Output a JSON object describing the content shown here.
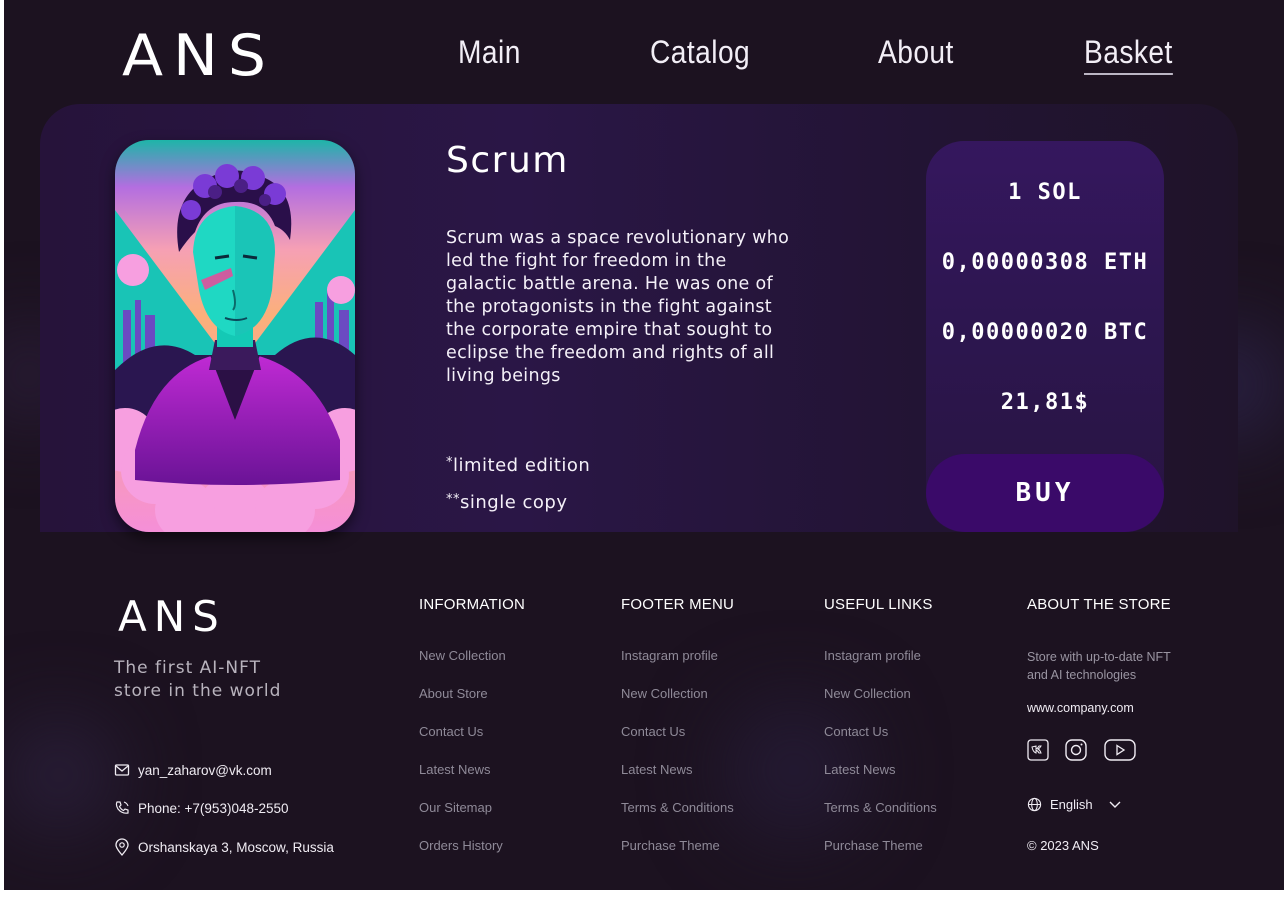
{
  "header": {
    "logo": "ANS",
    "nav": [
      "Main",
      "Catalog",
      "About",
      "Basket"
    ]
  },
  "product": {
    "name": "Scrum",
    "description": "Scrum was a space revolutionary who led the fight for freedom in the galactic battle arena. He was one of the protagonists in the fight against the corporate empire that sought to eclipse the freedom and rights of all living beings",
    "note1_mark": "*",
    "note1": "limited edition",
    "note2_mark": "**",
    "note2": "single copy",
    "prices": [
      "1 SOL",
      "0,00000308 ETH",
      "0,00000020 BTC",
      "21,81$"
    ],
    "buy_label": "BUY"
  },
  "footer": {
    "logo": "ANS",
    "tagline": "The first AI-NFT store in the world",
    "contacts": {
      "email": "yan_zaharov@vk.com",
      "phone": "Phone: +7(953)048-2550",
      "address": "Orshanskaya 3, Moscow, Russia"
    },
    "columns": [
      {
        "heading": "INFORMATION",
        "links": [
          "New Collection",
          "About Store",
          "Contact Us",
          "Latest News",
          "Our Sitemap",
          "Orders History"
        ]
      },
      {
        "heading": "FOOTER MENU",
        "links": [
          "Instagram profile",
          "New Collection",
          "Contact Us",
          "Latest News",
          "Terms & Conditions",
          "Purchase Theme"
        ]
      },
      {
        "heading": "USEFUL LINKS",
        "links": [
          "Instagram profile",
          "New Collection",
          "Contact Us",
          "Latest News",
          "Terms & Conditions",
          "Purchase Theme"
        ]
      }
    ],
    "about": {
      "heading": "ABOUT THE STORE",
      "text": "Store with up-to-date NFT and AI technologies",
      "url": "www.company.com",
      "socials": [
        "vk-icon",
        "instagram-icon",
        "youtube-icon"
      ],
      "language": "English",
      "copyright": "© 2023 ANS"
    }
  },
  "colors": {
    "background": "#1c1220",
    "panel": "#2a1646",
    "price_card": "#35175e",
    "buy_button": "#3a0a69",
    "muted_text": "#8f8a98"
  }
}
